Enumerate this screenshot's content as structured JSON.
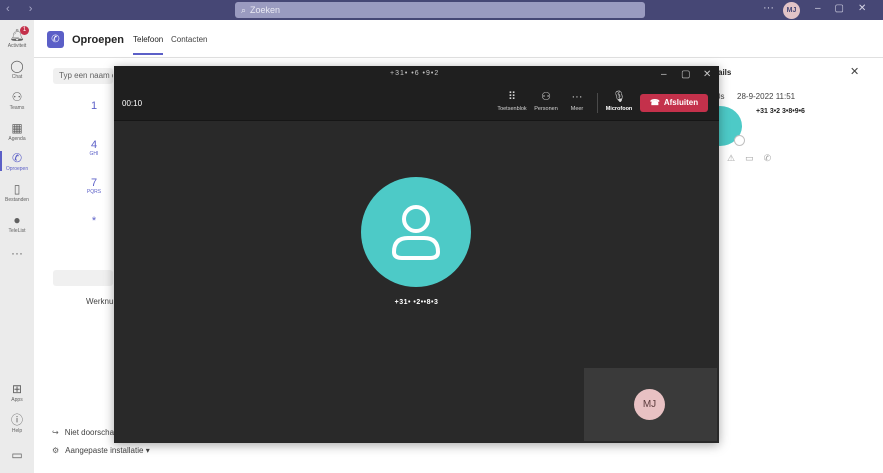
{
  "titlebar": {
    "search_placeholder": "Zoeken",
    "user_initials": "MJ",
    "more_icon": "ellipsis-icon"
  },
  "rail": {
    "items": [
      {
        "label": "Activiteit",
        "icon": "bell-icon",
        "badge": "1"
      },
      {
        "label": "Chat",
        "icon": "chat-icon"
      },
      {
        "label": "Teams",
        "icon": "teams-icon"
      },
      {
        "label": "Agenda",
        "icon": "calendar-icon"
      },
      {
        "label": "Oproepen",
        "icon": "phone-icon"
      },
      {
        "label": "Bestanden",
        "icon": "file-icon"
      },
      {
        "label": "TeleList",
        "icon": "telelist-icon"
      },
      {
        "label": "Apps",
        "icon": "apps-icon"
      },
      {
        "label": "Help",
        "icon": "help-icon"
      }
    ]
  },
  "app": {
    "title": "Oproepen",
    "tabs": [
      "Telefoon",
      "Contacten"
    ]
  },
  "dialpad": {
    "input_placeholder": "Typ een naam o",
    "keys": [
      {
        "digit": "1",
        "letters": ""
      },
      {
        "digit": "4",
        "letters": "GHI"
      },
      {
        "digit": "7",
        "letters": "PQRS"
      },
      {
        "digit": "*",
        "letters": ""
      }
    ],
    "work_label": "Werknu",
    "options": [
      "Niet doorscha",
      "Aangepaste installatie"
    ]
  },
  "details": {
    "title": "ails",
    "duration": "0s",
    "date": "28-9-2022 11:51",
    "number": "+31 3•2 3•8•9•6"
  },
  "call": {
    "window_title": "+31• •6 •9•2",
    "timer": "00:10",
    "toolbar": {
      "dialpad_label": "Toetsenblok",
      "people_label": "Personen",
      "more_label": "Meer",
      "mic_label": "Microfoon",
      "hangup_label": "Afsluiten"
    },
    "caller_number": "+31• •2••8•3",
    "self_initials": "MJ"
  },
  "colors": {
    "accent": "#5b5fc7",
    "titlebar": "#464775",
    "hangup": "#c4314b",
    "caller_avatar": "#4dcac7",
    "call_bg": "#292929"
  }
}
